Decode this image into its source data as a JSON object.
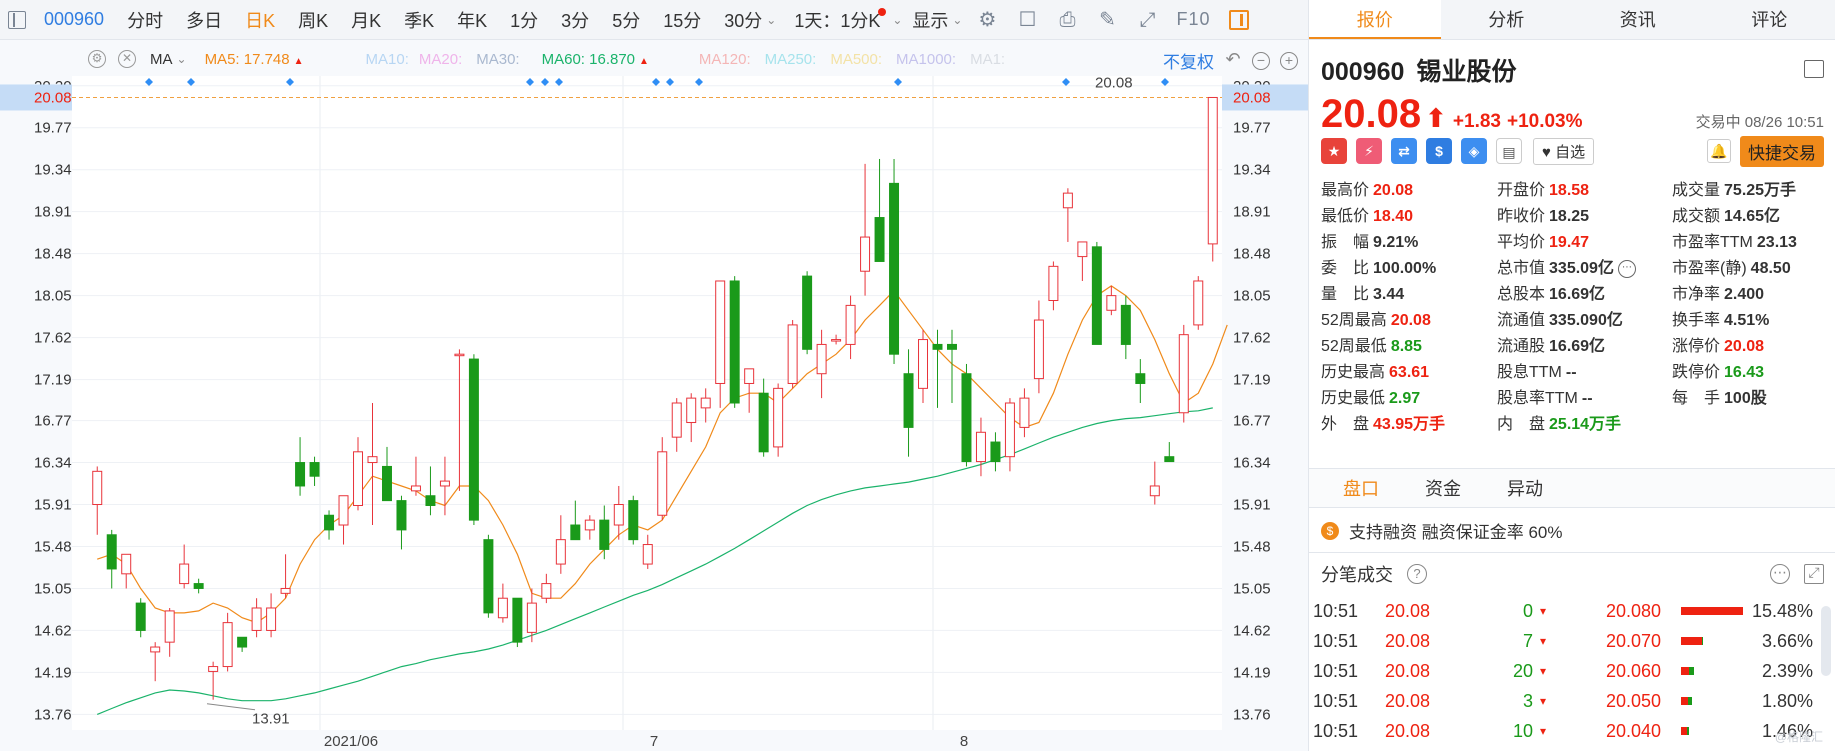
{
  "toolbar": {
    "code": "000960",
    "periods": [
      {
        "label": "分时",
        "active": false
      },
      {
        "label": "多日",
        "active": false
      },
      {
        "label": "日K",
        "active": true
      },
      {
        "label": "周K",
        "active": false
      },
      {
        "label": "月K",
        "active": false
      },
      {
        "label": "季K",
        "active": false
      },
      {
        "label": "年K",
        "active": false
      },
      {
        "label": "1分",
        "active": false
      },
      {
        "label": "3分",
        "active": false
      },
      {
        "label": "5分",
        "active": false
      },
      {
        "label": "15分",
        "active": false
      },
      {
        "label": "30分",
        "active": false
      }
    ],
    "interval_select": "1天：1分K",
    "display_label": "显示",
    "f10_label": "F10"
  },
  "ma_bar": {
    "name": "MA",
    "items": [
      {
        "label": "MA5: 17.748",
        "color": "#f08a1a",
        "arrow": "▲"
      },
      {
        "label": "MA10:",
        "color": "#b7d6f3",
        "arrow": ""
      },
      {
        "label": "MA20:",
        "color": "#efb4ea",
        "arrow": ""
      },
      {
        "label": "MA30:",
        "color": "#a9b8cf",
        "arrow": ""
      },
      {
        "label": "MA60: 16.870",
        "color": "#1bb36b",
        "arrow": "▲"
      },
      {
        "label": "MA120:",
        "color": "#f4b6b6",
        "arrow": ""
      },
      {
        "label": "MA250:",
        "color": "#a6e3ec",
        "arrow": ""
      },
      {
        "label": "MA500:",
        "color": "#f3e2a6",
        "arrow": ""
      },
      {
        "label": "MA1000:",
        "color": "#c5c3ec",
        "arrow": ""
      },
      {
        "label": "MA1:",
        "color": "#d9dde3",
        "arrow": ""
      }
    ],
    "fuquan": "不复权"
  },
  "chart_data": {
    "type": "candlestick",
    "y_ticks": [
      "20.20",
      "19.77",
      "19.34",
      "18.91",
      "18.48",
      "18.05",
      "17.62",
      "17.19",
      "16.77",
      "16.34",
      "15.91",
      "15.48",
      "15.05",
      "14.62",
      "14.19",
      "13.76"
    ],
    "ylim": [
      13.6,
      20.3
    ],
    "x_labels": [
      "2021/06",
      "7",
      "8"
    ],
    "current_price_label": "20.08",
    "high_annotation": "20.08",
    "low_annotation": "13.91",
    "candles": [
      {
        "o": 15.91,
        "h": 16.3,
        "l": 15.6,
        "c": 16.25
      },
      {
        "o": 15.6,
        "h": 15.65,
        "l": 15.05,
        "c": 15.25
      },
      {
        "o": 15.2,
        "h": 15.4,
        "l": 15.05,
        "c": 15.4
      },
      {
        "o": 14.9,
        "h": 14.95,
        "l": 14.55,
        "c": 14.62
      },
      {
        "o": 14.4,
        "h": 14.5,
        "l": 14.1,
        "c": 14.45
      },
      {
        "o": 14.5,
        "h": 14.85,
        "l": 14.35,
        "c": 14.82
      },
      {
        "o": 15.1,
        "h": 15.5,
        "l": 15.05,
        "c": 15.3
      },
      {
        "o": 15.1,
        "h": 15.15,
        "l": 15.0,
        "c": 15.05
      },
      {
        "o": 14.2,
        "h": 14.3,
        "l": 13.91,
        "c": 14.25
      },
      {
        "o": 14.25,
        "h": 14.8,
        "l": 14.2,
        "c": 14.7
      },
      {
        "o": 14.55,
        "h": 14.55,
        "l": 14.4,
        "c": 14.45
      },
      {
        "o": 14.62,
        "h": 14.95,
        "l": 14.55,
        "c": 14.85
      },
      {
        "o": 14.62,
        "h": 15.0,
        "l": 14.55,
        "c": 14.85
      },
      {
        "o": 15.0,
        "h": 15.4,
        "l": 14.95,
        "c": 15.05
      },
      {
        "o": 16.34,
        "h": 16.6,
        "l": 16.0,
        "c": 16.1
      },
      {
        "o": 16.34,
        "h": 16.4,
        "l": 16.1,
        "c": 16.2
      },
      {
        "o": 15.8,
        "h": 15.85,
        "l": 15.55,
        "c": 15.65
      },
      {
        "o": 15.7,
        "h": 16.0,
        "l": 15.5,
        "c": 16.0
      },
      {
        "o": 15.9,
        "h": 16.6,
        "l": 15.85,
        "c": 16.45
      },
      {
        "o": 16.34,
        "h": 16.95,
        "l": 15.7,
        "c": 16.4
      },
      {
        "o": 16.3,
        "h": 16.5,
        "l": 15.95,
        "c": 15.95
      },
      {
        "o": 15.95,
        "h": 16.0,
        "l": 15.45,
        "c": 15.65
      },
      {
        "o": 16.05,
        "h": 16.4,
        "l": 16.0,
        "c": 16.1
      },
      {
        "o": 16.0,
        "h": 16.3,
        "l": 15.8,
        "c": 15.9
      },
      {
        "o": 16.1,
        "h": 16.4,
        "l": 15.8,
        "c": 16.15
      },
      {
        "o": 17.45,
        "h": 17.5,
        "l": 16.05,
        "c": 17.45
      },
      {
        "o": 17.4,
        "h": 17.45,
        "l": 15.7,
        "c": 15.75
      },
      {
        "o": 15.55,
        "h": 15.6,
        "l": 14.75,
        "c": 14.8
      },
      {
        "o": 14.75,
        "h": 15.1,
        "l": 14.7,
        "c": 14.95
      },
      {
        "o": 14.95,
        "h": 14.95,
        "l": 14.45,
        "c": 14.5
      },
      {
        "o": 14.6,
        "h": 15.05,
        "l": 14.5,
        "c": 14.9
      },
      {
        "o": 14.95,
        "h": 15.2,
        "l": 14.9,
        "c": 15.1
      },
      {
        "o": 15.3,
        "h": 15.8,
        "l": 15.2,
        "c": 15.55
      },
      {
        "o": 15.7,
        "h": 15.95,
        "l": 15.55,
        "c": 15.55
      },
      {
        "o": 15.65,
        "h": 15.8,
        "l": 15.55,
        "c": 15.75
      },
      {
        "o": 15.75,
        "h": 15.9,
        "l": 15.35,
        "c": 15.45
      },
      {
        "o": 15.7,
        "h": 16.1,
        "l": 15.55,
        "c": 15.91
      },
      {
        "o": 15.95,
        "h": 16.0,
        "l": 15.5,
        "c": 15.55
      },
      {
        "o": 15.3,
        "h": 15.6,
        "l": 15.25,
        "c": 15.5
      },
      {
        "o": 15.8,
        "h": 16.6,
        "l": 15.75,
        "c": 16.45
      },
      {
        "o": 16.6,
        "h": 17.0,
        "l": 16.45,
        "c": 16.95
      },
      {
        "o": 16.75,
        "h": 17.05,
        "l": 16.55,
        "c": 17.0
      },
      {
        "o": 16.9,
        "h": 17.1,
        "l": 16.75,
        "c": 17.0
      },
      {
        "o": 17.15,
        "h": 18.2,
        "l": 16.9,
        "c": 18.2
      },
      {
        "o": 18.2,
        "h": 18.25,
        "l": 16.9,
        "c": 16.95
      },
      {
        "o": 17.15,
        "h": 17.3,
        "l": 16.85,
        "c": 17.3
      },
      {
        "o": 17.05,
        "h": 17.2,
        "l": 16.4,
        "c": 16.45
      },
      {
        "o": 16.5,
        "h": 17.15,
        "l": 16.4,
        "c": 17.1
      },
      {
        "o": 17.15,
        "h": 17.8,
        "l": 17.1,
        "c": 17.75
      },
      {
        "o": 18.25,
        "h": 18.3,
        "l": 17.45,
        "c": 17.5
      },
      {
        "o": 17.25,
        "h": 17.7,
        "l": 17.0,
        "c": 17.55
      },
      {
        "o": 17.6,
        "h": 17.65,
        "l": 17.55,
        "c": 17.6
      },
      {
        "o": 17.55,
        "h": 18.05,
        "l": 17.4,
        "c": 17.95
      },
      {
        "o": 18.3,
        "h": 19.4,
        "l": 18.05,
        "c": 18.65
      },
      {
        "o": 18.85,
        "h": 19.45,
        "l": 18.6,
        "c": 18.4
      },
      {
        "o": 19.2,
        "h": 19.45,
        "l": 17.35,
        "c": 17.45
      },
      {
        "o": 17.25,
        "h": 17.5,
        "l": 16.4,
        "c": 16.7
      },
      {
        "o": 17.1,
        "h": 17.7,
        "l": 16.95,
        "c": 17.6
      },
      {
        "o": 17.55,
        "h": 17.7,
        "l": 16.9,
        "c": 17.5
      },
      {
        "o": 17.55,
        "h": 17.7,
        "l": 16.95,
        "c": 17.5
      },
      {
        "o": 17.25,
        "h": 17.35,
        "l": 16.3,
        "c": 16.35
      },
      {
        "o": 16.35,
        "h": 16.8,
        "l": 16.2,
        "c": 16.65
      },
      {
        "o": 16.55,
        "h": 16.65,
        "l": 16.25,
        "c": 16.35
      },
      {
        "o": 16.4,
        "h": 17.0,
        "l": 16.25,
        "c": 16.95
      },
      {
        "o": 16.7,
        "h": 17.1,
        "l": 16.6,
        "c": 17.0
      },
      {
        "o": 17.2,
        "h": 18.0,
        "l": 17.05,
        "c": 17.8
      },
      {
        "o": 18.0,
        "h": 18.4,
        "l": 17.9,
        "c": 18.35
      },
      {
        "o": 18.95,
        "h": 19.15,
        "l": 18.6,
        "c": 19.1
      },
      {
        "o": 18.45,
        "h": 18.6,
        "l": 18.2,
        "c": 18.6
      },
      {
        "o": 18.55,
        "h": 18.6,
        "l": 17.55,
        "c": 17.55
      },
      {
        "o": 17.9,
        "h": 18.15,
        "l": 17.85,
        "c": 18.05
      },
      {
        "o": 17.95,
        "h": 18.05,
        "l": 17.4,
        "c": 17.55
      },
      {
        "o": 17.25,
        "h": 17.4,
        "l": 16.95,
        "c": 17.15
      },
      {
        "o": 16.0,
        "h": 16.35,
        "l": 15.91,
        "c": 16.1
      },
      {
        "o": 16.4,
        "h": 16.55,
        "l": 16.35,
        "c": 16.35
      },
      {
        "o": 16.85,
        "h": 17.75,
        "l": 16.75,
        "c": 17.65
      },
      {
        "o": 17.75,
        "h": 18.25,
        "l": 17.7,
        "c": 18.2
      },
      {
        "o": 18.58,
        "h": 20.08,
        "l": 18.4,
        "c": 20.08
      }
    ],
    "ma5": [
      15.35,
      15.4,
      15.3,
      15.05,
      14.85,
      14.8,
      14.8,
      14.82,
      14.9,
      14.85,
      14.75,
      14.7,
      14.8,
      14.95,
      15.3,
      15.55,
      15.7,
      15.8,
      16.0,
      16.2,
      16.15,
      16.1,
      16.05,
      15.95,
      15.9,
      16.1,
      16.1,
      15.95,
      15.7,
      15.4,
      15.0,
      14.95,
      14.95,
      15.1,
      15.3,
      15.45,
      15.6,
      15.7,
      15.65,
      15.75,
      16.0,
      16.25,
      16.5,
      16.85,
      17.0,
      17.05,
      17.05,
      16.95,
      17.1,
      17.25,
      17.35,
      17.45,
      17.6,
      17.8,
      17.95,
      18.1,
      17.9,
      17.7,
      17.5,
      17.35,
      17.25,
      17.1,
      16.95,
      16.8,
      16.7,
      16.75,
      17.05,
      17.45,
      17.8,
      18.05,
      18.15,
      18.05,
      17.9,
      17.6,
      17.25,
      16.95,
      17.05,
      17.35,
      17.75
    ],
    "ma60": [
      13.76,
      13.82,
      13.88,
      13.93,
      13.98,
      14.01,
      14.0,
      13.98,
      13.95,
      13.92,
      13.9,
      13.9,
      13.9,
      13.92,
      13.95,
      13.98,
      14.02,
      14.06,
      14.1,
      14.15,
      14.2,
      14.25,
      14.28,
      14.32,
      14.35,
      14.38,
      14.4,
      14.43,
      14.47,
      14.52,
      14.57,
      14.62,
      14.68,
      14.74,
      14.8,
      14.86,
      14.92,
      14.98,
      15.03,
      15.09,
      15.16,
      15.23,
      15.3,
      15.38,
      15.46,
      15.55,
      15.64,
      15.73,
      15.82,
      15.9,
      15.96,
      16.01,
      16.05,
      16.08,
      16.1,
      16.12,
      16.14,
      16.17,
      16.2,
      16.24,
      16.28,
      16.32,
      16.37,
      16.42,
      16.48,
      16.54,
      16.6,
      16.65,
      16.7,
      16.74,
      16.77,
      16.79,
      16.8,
      16.82,
      16.84,
      16.86,
      16.87,
      16.9
    ]
  },
  "quote": {
    "code": "000960",
    "name": "锡业股份",
    "price": "20.08",
    "arrow": "⬆",
    "change": "+1.83",
    "change_pct": "+10.03%",
    "status_time": "交易中 08/26 10:51",
    "zixuan_label": "自选",
    "quick_trade_label": "快捷交易",
    "rows": [
      [
        {
          "label": "最高价",
          "value": "20.08",
          "cls": "red"
        },
        {
          "label": "开盘价",
          "value": "18.58",
          "cls": "red"
        },
        {
          "label": "成交量",
          "value": "75.25万手",
          "cls": ""
        }
      ],
      [
        {
          "label": "最低价",
          "value": "18.40",
          "cls": "red"
        },
        {
          "label": "昨收价",
          "value": "18.25",
          "cls": ""
        },
        {
          "label": "成交额",
          "value": "14.65亿",
          "cls": ""
        }
      ],
      [
        {
          "label": "振　幅",
          "value": "9.21%",
          "cls": ""
        },
        {
          "label": "平均价",
          "value": "19.47",
          "cls": "red"
        },
        {
          "label": "市盈率TTM",
          "value": "23.13",
          "cls": ""
        }
      ],
      [
        {
          "label": "委　比",
          "value": "100.00%",
          "cls": ""
        },
        {
          "label": "总市值",
          "value": "335.09亿",
          "cls": ""
        },
        {
          "label": "市盈率(静)",
          "value": "48.50",
          "cls": ""
        }
      ],
      [
        {
          "label": "量　比",
          "value": "3.44",
          "cls": ""
        },
        {
          "label": "总股本",
          "value": "16.69亿",
          "cls": ""
        },
        {
          "label": "市净率",
          "value": "2.400",
          "cls": ""
        }
      ],
      [
        {
          "label": "52周最高",
          "value": "20.08",
          "cls": "red"
        },
        {
          "label": "流通值",
          "value": "335.090亿",
          "cls": ""
        },
        {
          "label": "换手率",
          "value": "4.51%",
          "cls": ""
        }
      ],
      [
        {
          "label": "52周最低",
          "value": "8.85",
          "cls": "green"
        },
        {
          "label": "流通股",
          "value": "16.69亿",
          "cls": ""
        },
        {
          "label": "涨停价",
          "value": "20.08",
          "cls": "red"
        }
      ],
      [
        {
          "label": "历史最高",
          "value": "63.61",
          "cls": "red"
        },
        {
          "label": "股息TTM",
          "value": "--",
          "cls": ""
        },
        {
          "label": "跌停价",
          "value": "16.43",
          "cls": "green"
        }
      ],
      [
        {
          "label": "历史最低",
          "value": "2.97",
          "cls": "green"
        },
        {
          "label": "股息率TTM",
          "value": "--",
          "cls": ""
        },
        {
          "label": "每　手",
          "value": "100股",
          "cls": ""
        }
      ],
      [
        {
          "label": "外　盘",
          "value": "43.95万手",
          "cls": "red"
        },
        {
          "label": "内　盘",
          "value": "25.14万手",
          "cls": "green"
        },
        {
          "label": "",
          "value": "",
          "cls": ""
        }
      ]
    ]
  },
  "right_tabs": [
    "报价",
    "分析",
    "资讯",
    "评论"
  ],
  "sub_tabs": [
    "盘口",
    "资金",
    "异动"
  ],
  "margin_text": "支持融资  融资保证金率 60%",
  "ticks_title": "分笔成交",
  "ticks": [
    {
      "time": "10:51",
      "price": "20.08",
      "vol": "0",
      "level": "20.080",
      "pct": "15.48%",
      "bar_red": 0.88,
      "bar_green": 0.0
    },
    {
      "time": "10:51",
      "price": "20.08",
      "vol": "7",
      "level": "20.070",
      "pct": "3.66%",
      "bar_red": 0.3,
      "bar_green": 0.02
    },
    {
      "time": "10:51",
      "price": "20.08",
      "vol": "20",
      "level": "20.060",
      "pct": "2.39%",
      "bar_red": 0.12,
      "bar_green": 0.06
    },
    {
      "time": "10:51",
      "price": "20.08",
      "vol": "3",
      "level": "20.050",
      "pct": "1.80%",
      "bar_red": 0.1,
      "bar_green": 0.05
    },
    {
      "time": "10:51",
      "price": "20.08",
      "vol": "10",
      "level": "20.040",
      "pct": "1.46%",
      "bar_red": 0.08,
      "bar_green": 0.03
    }
  ],
  "watermark": "@格隆汇"
}
